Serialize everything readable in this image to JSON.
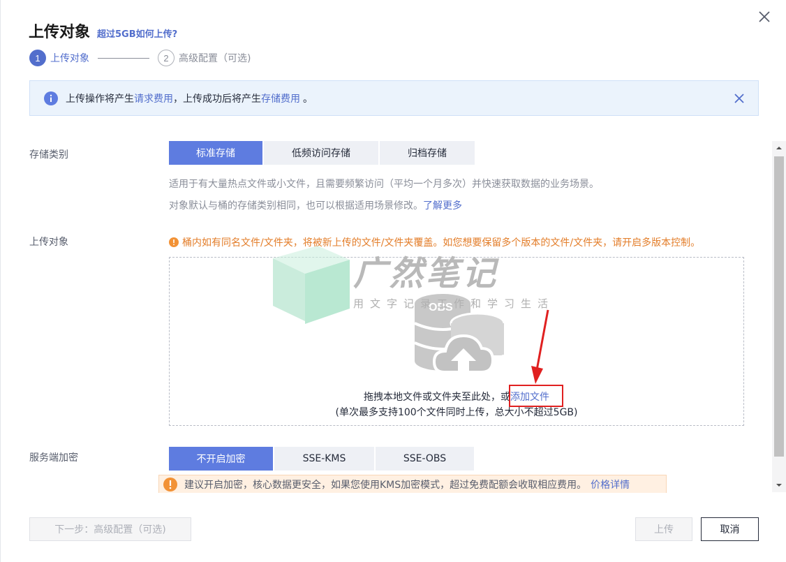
{
  "header": {
    "title": "上传对象",
    "help_link": "超过5GB如何上传?"
  },
  "steps": [
    {
      "num": "1",
      "label": "上传对象"
    },
    {
      "num": "2",
      "label": "高级配置（可选)"
    }
  ],
  "notice": {
    "prefix": "上传操作将产生",
    "link1": "请求费用",
    "middle": "，上传成功后将产生",
    "link2": "存储费用",
    "suffix": "。"
  },
  "storage_class": {
    "label": "存储类别",
    "options": [
      "标准存储",
      "低频访问存储",
      "归档存储"
    ],
    "selected": "标准存储",
    "desc1": "适用于有大量热点文件或小文件，且需要频繁访问（平均一个月多次）并快速获取数据的业务场景。",
    "desc2": "对象默认与桶的存储类别相同，也可以根据适用场景修改。",
    "learn_more": "了解更多"
  },
  "upload": {
    "label": "上传对象",
    "warning": "桶内如有同名文件/文件夹，将被新上传的文件/文件夹覆盖。如您想要保留多个版本的文件/文件夹，请开启多版本控制。",
    "drop_text": "拖拽本地文件或文件夹至此处，或",
    "add_file": "添加文件",
    "limit_text": "(单次最多支持100个文件同时上传，总大小不超过5GB)",
    "icon_text": "OBS"
  },
  "watermark": {
    "title": "广然笔记",
    "subtitle": "用文字记录工作和学习生活"
  },
  "encryption": {
    "label": "服务端加密",
    "options": [
      "不开启加密",
      "SSE-KMS",
      "SSE-OBS"
    ],
    "selected": "不开启加密",
    "tip": "建议开启加密，核心数据更安全，如果您使用KMS加密模式，超过免费配额会收取相应费用。",
    "tip_link": "价格详情"
  },
  "footer": {
    "next": "下一步：高级配置（可选)",
    "upload": "上传",
    "cancel": "取消"
  },
  "colors": {
    "primary": "#5e7ce0",
    "link": "#526ecc",
    "warning": "#e37d29",
    "highlight_box": "#e02020"
  }
}
